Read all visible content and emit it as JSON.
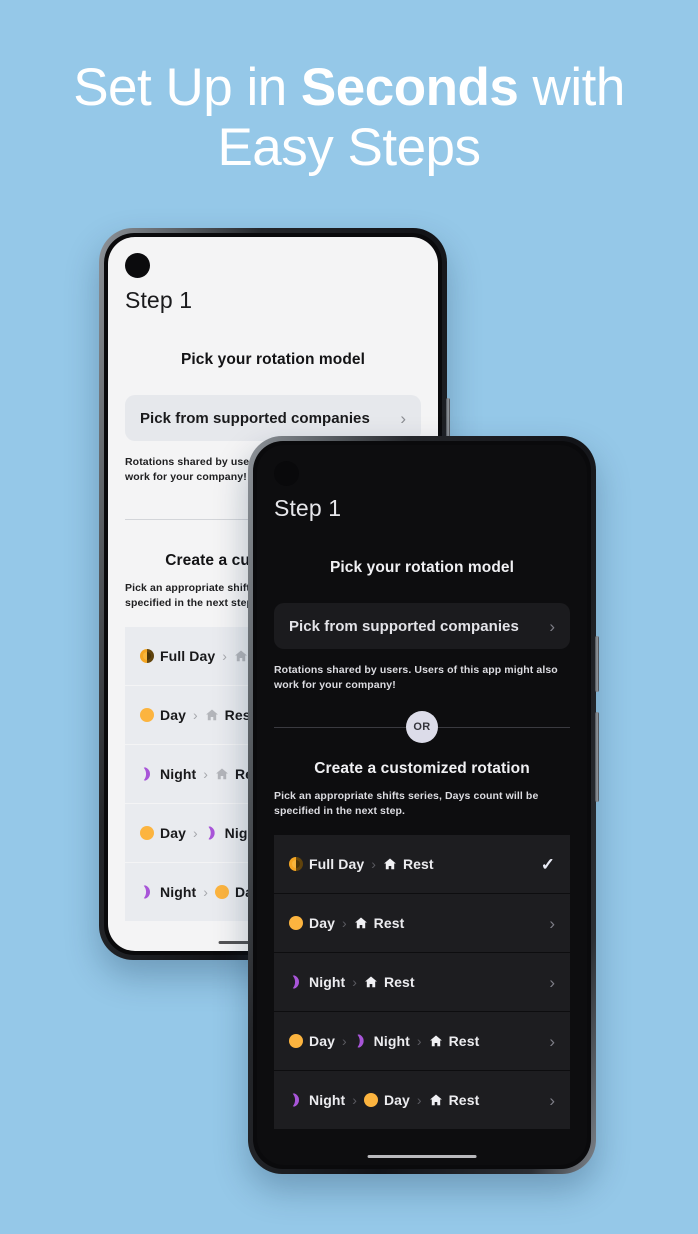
{
  "headline": {
    "line1_pre": "Set Up in ",
    "line1_strong": "Seconds",
    "line1_post": " with",
    "line2": "Easy Steps"
  },
  "colors": {
    "background": "#95c8e8",
    "headline_text": "#ffffff",
    "accent_day": "#fcb43f",
    "accent_full_day": "#f5a623",
    "accent_night": "#a855d8",
    "light_screen_bg": "#f4f4f5",
    "dark_screen_bg": "#0d0d0f",
    "light_card_bg": "#e9ebef",
    "dark_card_bg": "#1d1d20",
    "or_badge_bg": "#dcdce9",
    "checkmark": "#e9ebf5"
  },
  "app": {
    "step_title": "Step 1",
    "section_title": "Pick your rotation model",
    "pick_companies_label": "Pick from supported companies",
    "pick_companies_chevron": "chevron-right-icon",
    "companies_note": "Rotations shared by users. Users of this app might also work for your company!",
    "or_divider_label": "OR",
    "custom_title": "Create a customized rotation",
    "custom_note": "Pick an appropriate shifts series, Days count will be specified in the next step.",
    "rotations": [
      {
        "id": "full-day-rest",
        "sequence": [
          {
            "icon": "full-day-icon",
            "label": "Full Day"
          },
          {
            "icon": "rest-home-icon",
            "label": "Rest"
          }
        ],
        "trailing": "check-icon",
        "selected": true
      },
      {
        "id": "day-rest",
        "sequence": [
          {
            "icon": "day-icon",
            "label": "Day"
          },
          {
            "icon": "rest-home-icon",
            "label": "Rest"
          }
        ],
        "trailing": "chevron-right-icon",
        "selected": false
      },
      {
        "id": "night-rest",
        "sequence": [
          {
            "icon": "night-icon",
            "label": "Night"
          },
          {
            "icon": "rest-home-icon",
            "label": "Rest"
          }
        ],
        "trailing": "chevron-right-icon",
        "selected": false
      },
      {
        "id": "day-night-rest",
        "sequence": [
          {
            "icon": "day-icon",
            "label": "Day"
          },
          {
            "icon": "night-icon",
            "label": "Night"
          },
          {
            "icon": "rest-home-icon",
            "label": "Rest"
          }
        ],
        "trailing": "chevron-right-icon",
        "selected": false
      },
      {
        "id": "night-day-rest",
        "sequence": [
          {
            "icon": "night-icon",
            "label": "Night"
          },
          {
            "icon": "day-icon",
            "label": "Day"
          },
          {
            "icon": "rest-home-icon",
            "label": "Rest"
          }
        ],
        "trailing": "chevron-right-icon",
        "selected": false
      }
    ],
    "separator": "›",
    "chevron_glyph": "›",
    "check_glyph": "✓"
  },
  "phones": [
    {
      "id": "phone-light",
      "theme": "light",
      "label": "light-theme-phone-mockup"
    },
    {
      "id": "phone-dark",
      "theme": "dark",
      "label": "dark-theme-phone-mockup"
    }
  ]
}
